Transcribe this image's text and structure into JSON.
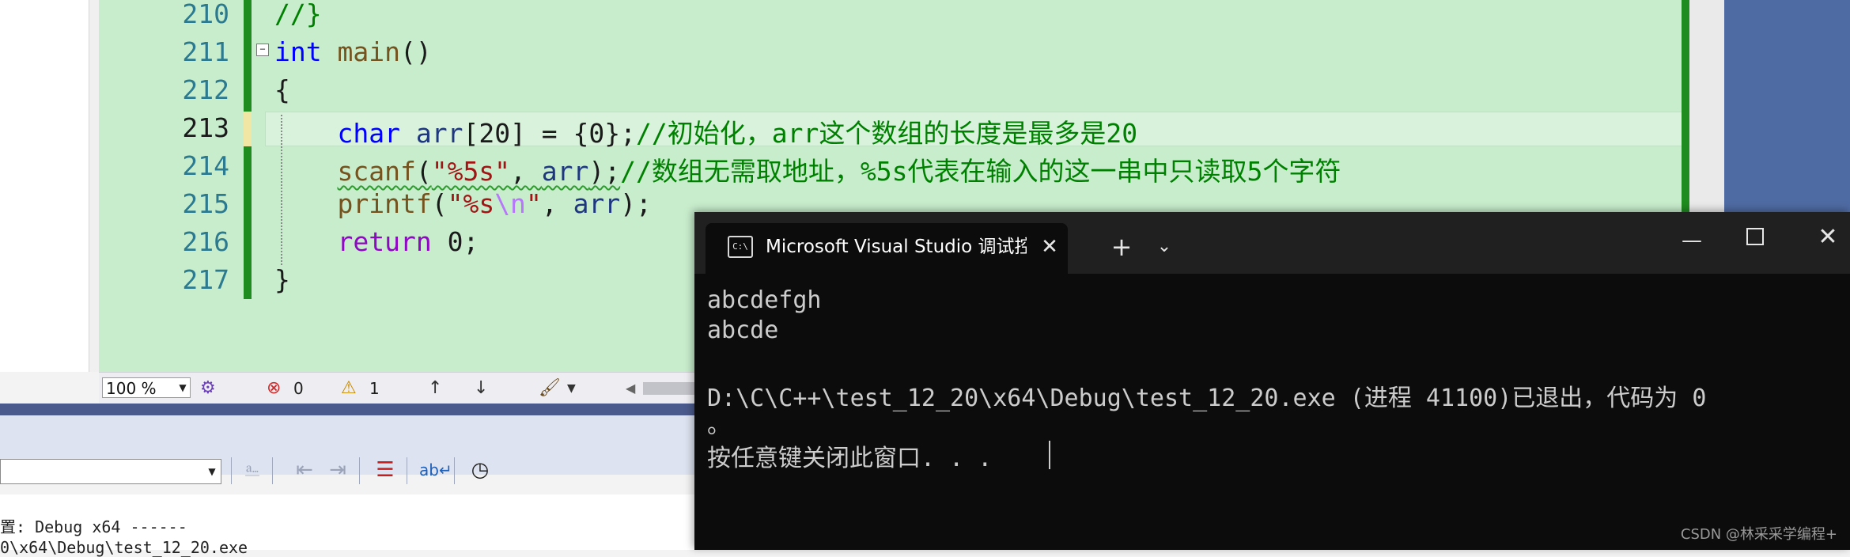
{
  "editor": {
    "line_numbers": [
      "210",
      "211",
      "212",
      "213",
      "214",
      "215",
      "216",
      "217"
    ],
    "fold_marker": "−"
  },
  "code": {
    "l210": {
      "comment": "//}"
    },
    "l211": {
      "kw": "int",
      "fn": "main",
      "punct": "()"
    },
    "l212": {
      "text": "{"
    },
    "l213": {
      "kw": "char",
      "var": "arr",
      "rest": "[20] = {0};",
      "comment": "//初始化，arr这个数组的长度是最多是20"
    },
    "l214": {
      "fn": "scanf",
      "p1": "(",
      "str": "\"%5s\"",
      "p2": ", ",
      "var": "arr",
      "p3": ");",
      "comment": "//数组无需取地址，%5s代表在输入的这一串中只读取5个字符"
    },
    "l215": {
      "fn": "printf",
      "p1": "(",
      "str1": "\"%s",
      "esc": "\\n",
      "str2": "\"",
      "p2": ", ",
      "var": "arr",
      "p3": ");"
    },
    "l216": {
      "kw": "return",
      "rest": " 0;"
    },
    "l217": {
      "text": "}"
    }
  },
  "status_bar": {
    "zoom": "100 %",
    "errors": "0",
    "warnings": "1",
    "up_arrow": "↑",
    "down_arrow": "↓"
  },
  "output": {
    "line1": "置: Debug x64 ------",
    "line2": "0\\x64\\Debug\\test_12_20.exe"
  },
  "console": {
    "tab_title": "Microsoft Visual Studio 调试控制台",
    "new_tab": "+",
    "lines": [
      "abcdefgh",
      "abcde",
      "",
      "D:\\C\\C++\\test_12_20\\x64\\Debug\\test_12_20.exe (进程 41100)已退出，代码为 0",
      "。",
      "按任意键关闭此窗口. . ."
    ],
    "watermark": "CSDN @林采采学编程+"
  }
}
